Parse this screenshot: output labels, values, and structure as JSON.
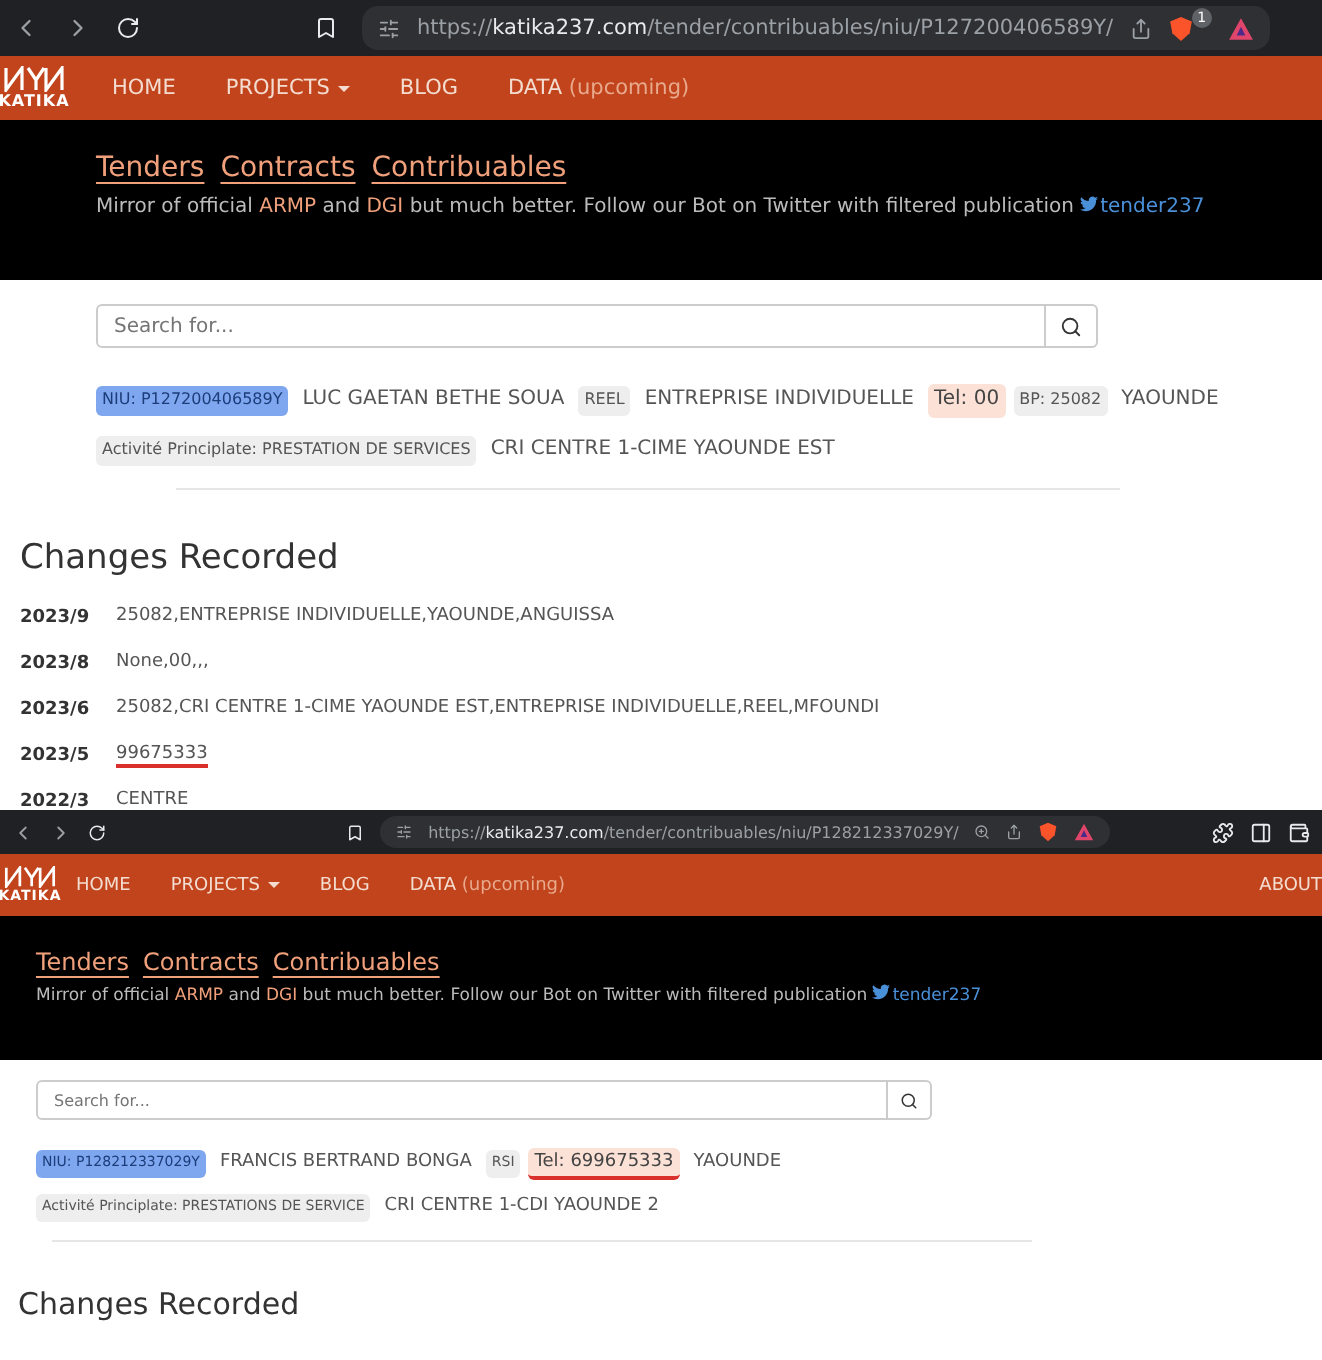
{
  "screenshots": [
    {
      "browser": {
        "scheme": "https://",
        "host": "katika237.com",
        "path": "/tender/contribuables/niu/P127200406589Y/",
        "shield_badge": "1",
        "extended_toolbar": false
      },
      "navbar": {
        "logo_text": "KATIKA",
        "items": [
          {
            "label": "HOME",
            "dropdown": false
          },
          {
            "label": "PROJECTS",
            "dropdown": true
          },
          {
            "label": "BLOG",
            "dropdown": false
          },
          {
            "label": "DATA",
            "note": "(upcoming)",
            "dropdown": false
          }
        ]
      },
      "hero": {
        "links": [
          "Tenders",
          "Contracts",
          "Contribuables"
        ],
        "tagline": [
          {
            "kind": "text",
            "text": "Mirror of official "
          },
          {
            "kind": "link",
            "text": "ARMP"
          },
          {
            "kind": "text",
            "text": " and "
          },
          {
            "kind": "link",
            "text": "DGI"
          },
          {
            "kind": "text",
            "text": " but much better. Follow our Bot on Twitter with filtered publication "
          },
          {
            "kind": "twitter",
            "text": "tender237"
          }
        ]
      },
      "search": {
        "placeholder": "Search for..."
      },
      "info_rows": [
        [
          {
            "kind": "niu",
            "text": "NIU: P127200406589Y",
            "underlined": false
          },
          {
            "kind": "text",
            "text": "LUC GAETAN BETHE SOUA",
            "underlined": false
          },
          {
            "kind": "tag",
            "text": "REEL",
            "underlined": false
          },
          {
            "kind": "text",
            "text": "ENTREPRISE INDIVIDUELLE",
            "underlined": false
          },
          {
            "kind": "tel",
            "text": "Tel: 00",
            "underlined": false
          },
          {
            "kind": "tag",
            "text": "BP: 25082",
            "underlined": false
          },
          {
            "kind": "text",
            "text": "YAOUNDE",
            "underlined": false
          }
        ],
        [
          {
            "kind": "tag",
            "text": "Activité Principlate: PRESTATION DE SERVICES",
            "underlined": false
          },
          {
            "kind": "text",
            "text": "CRI CENTRE 1-CIME YAOUNDE EST",
            "underlined": false
          }
        ]
      ],
      "changes_title": "Changes Recorded",
      "changes": [
        {
          "date": "2023/9",
          "value": "25082,ENTREPRISE INDIVIDUELLE,YAOUNDE,ANGUISSA",
          "underlined": false
        },
        {
          "date": "2023/8",
          "value": "None,00,,,",
          "underlined": false
        },
        {
          "date": "2023/6",
          "value": "25082,CRI CENTRE 1-CIME YAOUNDE EST,ENTREPRISE INDIVIDUELLE,REEL,MFOUNDI",
          "underlined": false
        },
        {
          "date": "2023/5",
          "value": "99675333",
          "underlined": true
        },
        {
          "date": "2022/3",
          "value": "CENTRE"
        }
      ]
    },
    {
      "browser": {
        "scheme": "https://",
        "host": "katika237.com",
        "path": "/tender/contribuables/niu/P128212337029Y/",
        "extended_toolbar": true
      },
      "navbar": {
        "logo_text": "KATIKA",
        "items": [
          {
            "label": "HOME",
            "dropdown": false
          },
          {
            "label": "PROJECTS",
            "dropdown": true
          },
          {
            "label": "BLOG",
            "dropdown": false
          },
          {
            "label": "DATA",
            "note": "(upcoming)",
            "dropdown": false
          }
        ],
        "right_items": [
          "ABOUT"
        ]
      },
      "hero": {
        "links": [
          "Tenders",
          "Contracts",
          "Contribuables"
        ],
        "tagline": [
          {
            "kind": "text",
            "text": "Mirror of official "
          },
          {
            "kind": "link",
            "text": "ARMP"
          },
          {
            "kind": "text",
            "text": " and "
          },
          {
            "kind": "link",
            "text": "DGI"
          },
          {
            "kind": "text",
            "text": " but much better. Follow our Bot on Twitter with filtered publication "
          },
          {
            "kind": "twitter",
            "text": "tender237"
          }
        ]
      },
      "search": {
        "placeholder": "Search for..."
      },
      "info_rows": [
        [
          {
            "kind": "niu",
            "text": "NIU: P128212337029Y",
            "underlined": false
          },
          {
            "kind": "text",
            "text": "FRANCIS BERTRAND BONGA",
            "underlined": false
          },
          {
            "kind": "tag",
            "text": "RSI",
            "underlined": false
          },
          {
            "kind": "tel",
            "text": "Tel: 699675333",
            "underlined": true
          },
          {
            "kind": "text",
            "text": "YAOUNDE",
            "underlined": false
          }
        ],
        [
          {
            "kind": "tag",
            "text": "Activité Principlate: PRESTATIONS DE SERVICE",
            "underlined": false
          },
          {
            "kind": "text",
            "text": "CRI CENTRE 1-CDI YAOUNDE 2",
            "underlined": false
          }
        ]
      ],
      "changes_title": "Changes Recorded"
    }
  ]
}
